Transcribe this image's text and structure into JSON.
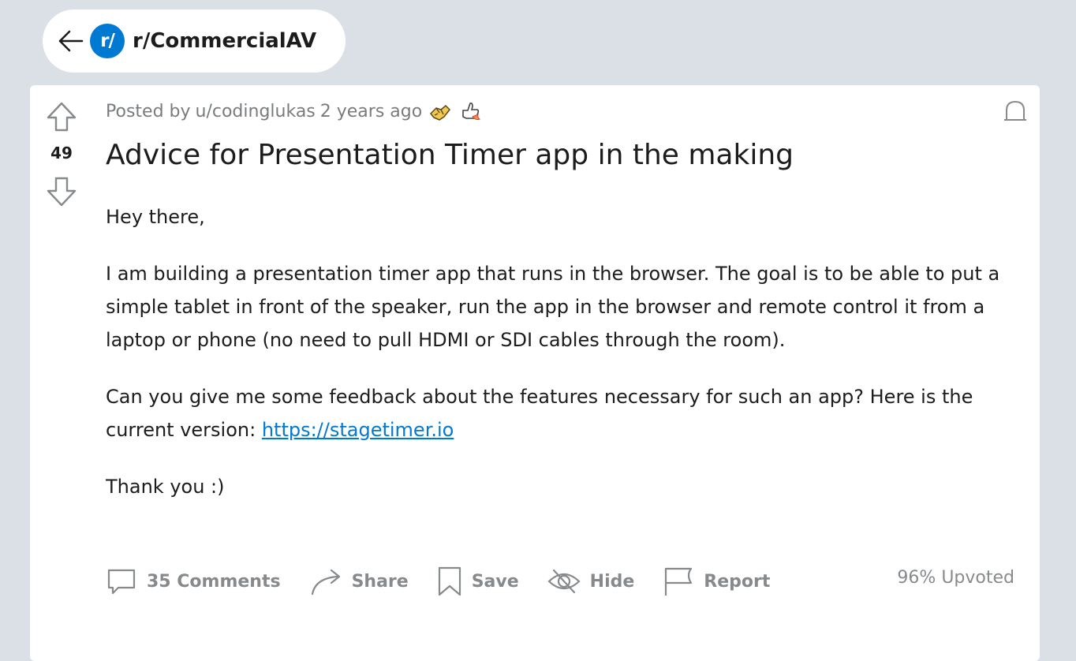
{
  "header": {
    "subreddit_icon_text": "r/",
    "subreddit_name": "r/CommercialAV"
  },
  "post": {
    "score": "49",
    "meta": {
      "posted_by_prefix": "Posted by",
      "author": "u/codinglukas",
      "time": "2 years ago"
    },
    "awards": [
      "gold-handshake-award-icon",
      "thumbs-up-rocket-award-icon"
    ],
    "title": "Advice for Presentation Timer app in the making",
    "body": {
      "p1": "Hey there,",
      "p2": "I am building a presentation timer app that runs in the browser. The goal is to be able to put a simple tablet in front of the speaker, run the app in the browser and remote control it from a laptop or phone (no need to pull HDMI or SDI cables through the room).",
      "p3_text": "Can you give me some feedback about the features necessary for such an app? Here is the current version: ",
      "p3_link": "https://stagetimer.io",
      "p4": "Thank you :)"
    },
    "actions": {
      "comments": "35 Comments",
      "share": "Share",
      "save": "Save",
      "hide": "Hide",
      "report": "Report"
    },
    "upvoted": "96% Upvoted"
  },
  "colors": {
    "background": "#dae0e6",
    "card": "#ffffff",
    "accent": "#0079d3",
    "muted": "#878a8c"
  }
}
